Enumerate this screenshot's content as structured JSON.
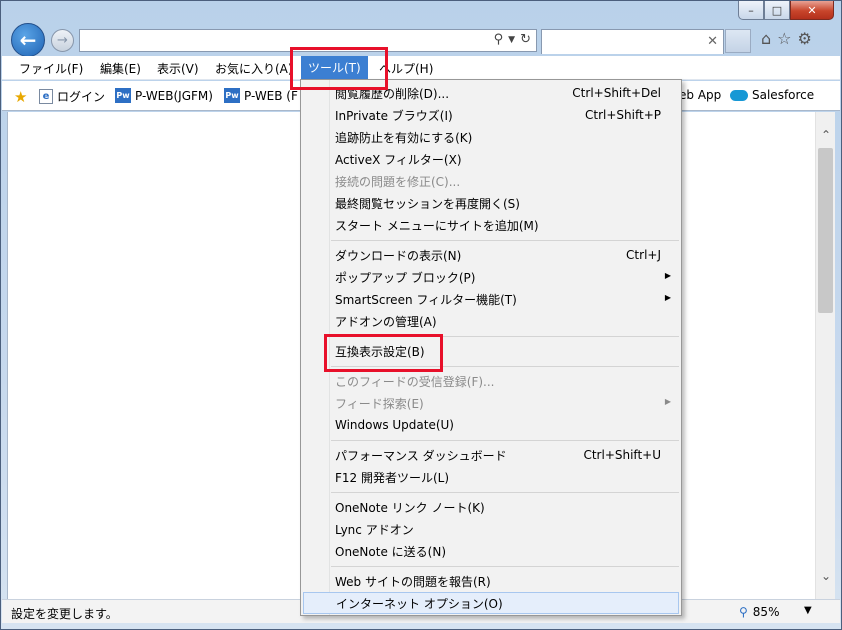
{
  "menubar": {
    "items": [
      "ファイル(F)",
      "編集(E)",
      "表示(V)",
      "お気に入り(A)",
      "ツール(T)",
      "ヘルプ(H)"
    ]
  },
  "favorites": {
    "items": [
      "ログイン",
      "P-WEB(JGFM)",
      "P-WEB (F",
      "eb App",
      "Salesforce"
    ]
  },
  "tools_menu": {
    "group1": [
      {
        "label": "閲覧履歴の削除(D)...",
        "shortcut": "Ctrl+Shift+Del"
      },
      {
        "label": "InPrivate ブラウズ(I)",
        "shortcut": "Ctrl+Shift+P"
      },
      {
        "label": "追跡防止を有効にする(K)",
        "shortcut": ""
      },
      {
        "label": "ActiveX フィルター(X)",
        "shortcut": ""
      },
      {
        "label": "接続の問題を修正(C)...",
        "shortcut": ""
      },
      {
        "label": "最終閲覧セッションを再度開く(S)",
        "shortcut": ""
      },
      {
        "label": "スタート メニューにサイトを追加(M)",
        "shortcut": ""
      }
    ],
    "group2": [
      {
        "label": "ダウンロードの表示(N)",
        "shortcut": "Ctrl+J"
      },
      {
        "label": "ポップアップ ブロック(P)",
        "shortcut": ""
      },
      {
        "label": "SmartScreen フィルター機能(T)",
        "shortcut": ""
      },
      {
        "label": "アドオンの管理(A)",
        "shortcut": ""
      }
    ],
    "group3": [
      {
        "label": "互換表示設定(B)",
        "shortcut": ""
      }
    ],
    "group4": [
      {
        "label": "このフィードの受信登録(F)...",
        "shortcut": ""
      },
      {
        "label": "フィード探索(E)",
        "shortcut": ""
      },
      {
        "label": "Windows Update(U)",
        "shortcut": ""
      }
    ],
    "group5": [
      {
        "label": "パフォーマンス ダッシュボード",
        "shortcut": "Ctrl+Shift+U"
      },
      {
        "label": "F12 開発者ツール(L)",
        "shortcut": ""
      }
    ],
    "group6": [
      {
        "label": "OneNote リンク ノート(K)",
        "shortcut": ""
      },
      {
        "label": "Lync アドオン",
        "shortcut": ""
      },
      {
        "label": "OneNote に送る(N)",
        "shortcut": ""
      }
    ],
    "group7": [
      {
        "label": "Web サイトの問題を報告(R)",
        "shortcut": ""
      },
      {
        "label": "インターネット オプション(O)",
        "shortcut": ""
      }
    ]
  },
  "status": {
    "text": "設定を変更します。",
    "zoom": "85%"
  },
  "colors": {
    "highlight_box": "#e8102a",
    "menu_active": "#3c7fd2"
  }
}
